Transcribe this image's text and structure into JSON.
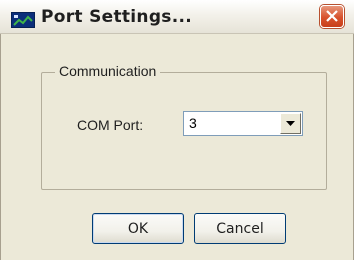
{
  "window": {
    "title": "Port Settings...",
    "icon": "app-icon",
    "close_icon": "close-x-icon"
  },
  "group": {
    "label": "Communication"
  },
  "com_port": {
    "label": "COM Port:",
    "value": "3"
  },
  "buttons": {
    "ok": "OK",
    "cancel": "Cancel"
  }
}
